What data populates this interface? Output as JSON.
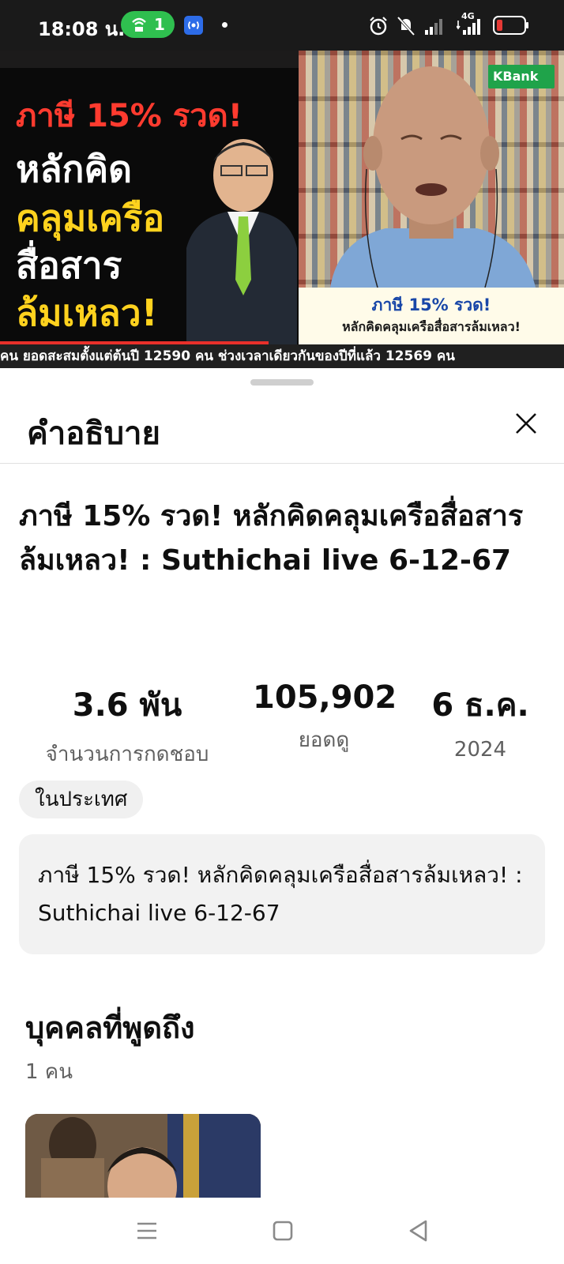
{
  "status_bar": {
    "time": "18:08 น.",
    "hotspot_count": "1",
    "network": "4G",
    "icons": [
      "hotspot-icon",
      "radio-icon",
      "alarm-icon",
      "mute-icon",
      "signal-icon",
      "battery-icon"
    ],
    "accent_color": "#2fbf4f",
    "battery_low_color": "#e53935"
  },
  "video": {
    "thumb_line1": "ภาษี 15% รวด!",
    "thumb_line2": "หลักคิด",
    "thumb_line3": "คลุมเครือ",
    "thumb_line4": "สื่อสาร",
    "thumb_line5": "ล้มเหลว!",
    "sponsor": "KBank",
    "caption_line1": "ภาษี 15% รวด!",
    "caption_line2": "หลักคิดคลุมเครือสื่อสารล้มเหลว!",
    "ticker": "คน ยอดสะสมตั้งแต่ต้นปี 12590 คน ช่วงเวลาเดียวกันของปีที่แล้ว 12569 คน"
  },
  "sheet": {
    "title": "คำอธิบาย",
    "video_title": "ภาษี 15% รวด! หลักคิดคลุมเครือสื่อสารล้มเหลว! : Suthichai live 6-12-67",
    "likes_value": "3.6 พัน",
    "likes_label": "จำนวนการกดชอบ",
    "views_value": "105,902",
    "views_label": "ยอดดู",
    "date_value": "6 ธ.ค.",
    "date_year": "2024",
    "chip": "ในประเทศ",
    "description": "ภาษี 15% รวด! หลักคิดคลุมเครือสื่อสารล้มเหลว! : Suthichai live 6-12-67",
    "people_heading": "บุคคลที่พูดถึง",
    "people_count": "1 คน"
  },
  "nav": {
    "icons": [
      "recents-icon",
      "home-icon",
      "back-icon"
    ]
  }
}
